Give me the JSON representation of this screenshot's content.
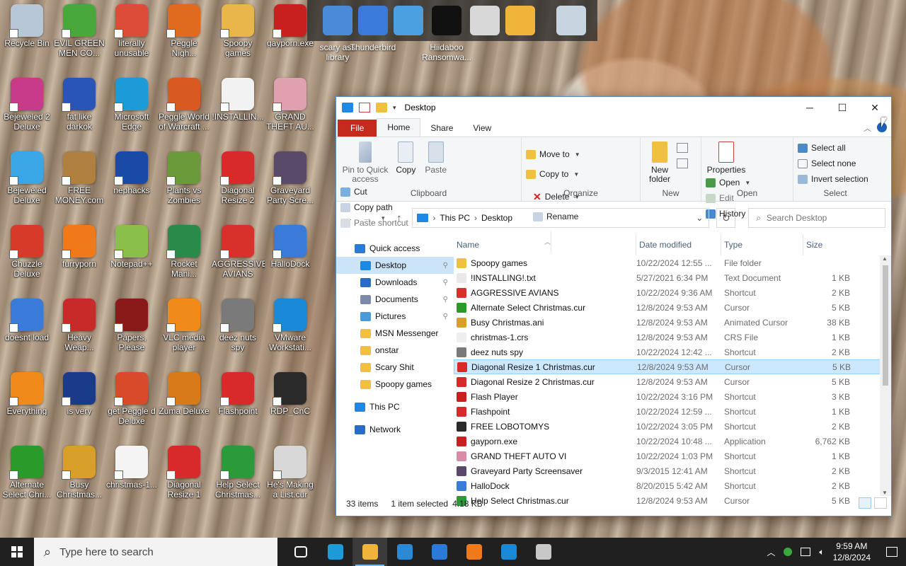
{
  "desktop_icons": [
    {
      "label": "Recycle Bin",
      "icon": "recycle-bin-icon",
      "color": "#b8c7d8"
    },
    {
      "label": "EVIL GREEN MEN CO...",
      "icon": "people-icon",
      "color": "#49a83c"
    },
    {
      "label": "literally unusable",
      "icon": "chrome-icon",
      "color": "#dd4b39"
    },
    {
      "label": "Peggle Nigh...",
      "icon": "peggle-icon",
      "color": "#e06b1f"
    },
    {
      "label": "Spoopy games",
      "icon": "folder-icon",
      "color": "#e8b64a"
    },
    {
      "label": "gayporn.exe",
      "icon": "flash-icon",
      "color": "#c8201e"
    },
    {
      "label": "Bejeweled 2 Deluxe",
      "icon": "gem-icon",
      "color": "#c83a8a"
    },
    {
      "label": "fat like darkok",
      "icon": "mpi-icon",
      "color": "#2a55b8"
    },
    {
      "label": "Microsoft Edge",
      "icon": "edge-icon",
      "color": "#1c9bd8"
    },
    {
      "label": "Peggle World of Warcraft ...",
      "icon": "peggle-icon",
      "color": "#d85a20"
    },
    {
      "label": "!INSTALLIN...",
      "icon": "document-icon",
      "color": "#f2f2f2"
    },
    {
      "label": "GRAND THEFT AU...",
      "icon": "anime-icon",
      "color": "#e0a0b0"
    },
    {
      "label": "Bejeweled Deluxe",
      "icon": "diamond-icon",
      "color": "#3aa6e6"
    },
    {
      "label": "FREE MONEY.com",
      "icon": "money-bag-icon",
      "color": "#b08040"
    },
    {
      "label": "nephacks",
      "icon": "mpi-icon",
      "color": "#1a4aa8"
    },
    {
      "label": "Plants vs Zombies",
      "icon": "plant-icon",
      "color": "#6a9a3a"
    },
    {
      "label": "Diagonal Resize 2 Ch...",
      "icon": "resize-arrow-icon",
      "color": "#d82a2a"
    },
    {
      "label": "Graveyard Party Scre...",
      "icon": "graveyard-icon",
      "color": "#5a4a6a"
    },
    {
      "label": "Chuzzle Deluxe",
      "icon": "chuzzle-icon",
      "color": "#d83a2a"
    },
    {
      "label": "furryporn",
      "icon": "firefox-icon",
      "color": "#f07a1a"
    },
    {
      "label": "Notepad++",
      "icon": "notepad-icon",
      "color": "#8ac04a"
    },
    {
      "label": "Rocket Mani...",
      "icon": "rocket-icon",
      "color": "#2a8a4a"
    },
    {
      "label": "AGGRESSIVE AVIANS",
      "icon": "bird-icon",
      "color": "#d8302a"
    },
    {
      "label": "HalloDock",
      "icon": "shield-icon",
      "color": "#3a7ad8"
    },
    {
      "label": "doesnt load",
      "icon": "thunderbird-icon",
      "color": "#3a7ad8"
    },
    {
      "label": "Heavy Weap...",
      "icon": "radiation-icon",
      "color": "#c82a2a"
    },
    {
      "label": "Papers, Please",
      "icon": "papers-icon",
      "color": "#8a1a1a"
    },
    {
      "label": "VLC media player",
      "icon": "vlc-icon",
      "color": "#f08a1a"
    },
    {
      "label": "deez nuts spy",
      "icon": "windows-stack-icon",
      "color": "#7a7a7a"
    },
    {
      "label": "VMware Workstati...",
      "icon": "vmware-icon",
      "color": "#1a8ad8"
    },
    {
      "label": "Everything",
      "icon": "search-ring-icon",
      "color": "#f08a1a"
    },
    {
      "label": "is very",
      "icon": "mpi-icon",
      "color": "#1a3a8a"
    },
    {
      "label": "get Peggle d Deluxe",
      "icon": "peggle-icon",
      "color": "#d84a2a"
    },
    {
      "label": "Zuma Deluxe",
      "icon": "zuma-icon",
      "color": "#d87a1a"
    },
    {
      "label": "Flashpoint",
      "icon": "flashpoint-icon",
      "color": "#d82a2a"
    },
    {
      "label": "RDP_CnC",
      "icon": "rdp-icon",
      "color": "#2a2a2a"
    },
    {
      "label": "Alternate Select Chri...",
      "icon": "green-arrow-icon",
      "color": "#2a9a2a"
    },
    {
      "label": "Busy Christmas...",
      "icon": "hourglass-icon",
      "color": "#d8a02a"
    },
    {
      "label": "christmas-1...",
      "icon": "blank-file-icon",
      "color": "#f4f4f4"
    },
    {
      "label": "Diagonal Resize 1 Ch...",
      "icon": "resize-arrow-icon",
      "color": "#d82a2a"
    },
    {
      "label": "Help Select Christmas...",
      "icon": "help-cursor-icon",
      "color": "#2a9a3a"
    },
    {
      "label": "He's Making a List.cur",
      "icon": "list-cursor-icon",
      "color": "#d8d8d8"
    }
  ],
  "top_dock": {
    "items": [
      {
        "label": "scary ass library",
        "icon": "network-pcs-icon",
        "color": "#4a8ad8"
      },
      {
        "label": "Thunderbird",
        "icon": "globe-icon",
        "color": "#3a7ad8"
      },
      {
        "label": "",
        "icon": "monitor-icon",
        "color": "#4aa0e0"
      },
      {
        "label": "Hiidaboo Ransomwa...",
        "icon": "yashma-icon",
        "color": "#111111"
      },
      {
        "label": "",
        "icon": "drive-icon",
        "color": "#d8d8d8"
      },
      {
        "label": "",
        "icon": "folder-icon",
        "color": "#f0b43a"
      },
      {
        "label": "",
        "icon": "recycle-bin-icon",
        "color": "#c8d4e0"
      }
    ]
  },
  "window": {
    "title": "Desktop",
    "controls": {
      "minimize": "─",
      "maximize": "☐",
      "close": "✕"
    },
    "tabs": [
      "File",
      "Home",
      "Share",
      "View"
    ],
    "active_tab": "Home",
    "ribbon": {
      "clipboard": {
        "name": "Clipboard",
        "pin": "Pin to Quick access",
        "copy": "Copy",
        "paste": "Paste",
        "cut": "Cut",
        "copy_path": "Copy path",
        "paste_shortcut": "Paste shortcut"
      },
      "organize": {
        "name": "Organize",
        "move_to": "Move to",
        "copy_to": "Copy to",
        "delete": "Delete",
        "rename": "Rename"
      },
      "new": {
        "name": "New",
        "new_folder": "New folder"
      },
      "open": {
        "name": "Open",
        "properties": "Properties",
        "open": "Open",
        "edit": "Edit",
        "history": "History"
      },
      "select": {
        "name": "Select",
        "select_all": "Select all",
        "select_none": "Select none",
        "invert": "Invert selection"
      }
    },
    "address": {
      "this_pc": "This PC",
      "sep": "›",
      "folder": "Desktop"
    },
    "search": {
      "placeholder": "Search Desktop"
    },
    "nav": [
      {
        "label": "Quick access",
        "icon": "star-icon",
        "color": "#2a7ad8",
        "level": 0,
        "pinned": false
      },
      {
        "label": "Desktop",
        "icon": "desktop-icon",
        "color": "#1e88e5",
        "level": 1,
        "pinned": true,
        "selected": true
      },
      {
        "label": "Downloads",
        "icon": "download-icon",
        "color": "#2a6ac8",
        "level": 1,
        "pinned": true
      },
      {
        "label": "Documents",
        "icon": "documents-icon",
        "color": "#7a8aa8",
        "level": 1,
        "pinned": true
      },
      {
        "label": "Pictures",
        "icon": "pictures-icon",
        "color": "#4a9ad8",
        "level": 1,
        "pinned": true
      },
      {
        "label": "MSN Messenger",
        "icon": "folder-icon",
        "color": "#f0c040",
        "level": 1,
        "pinned": false
      },
      {
        "label": "onstar",
        "icon": "folder-icon",
        "color": "#f0c040",
        "level": 1,
        "pinned": false
      },
      {
        "label": "Scary Shit",
        "icon": "folder-icon",
        "color": "#f0c040",
        "level": 1,
        "pinned": false
      },
      {
        "label": "Spoopy games",
        "icon": "folder-icon",
        "color": "#f0c040",
        "level": 1,
        "pinned": false
      },
      {
        "label": "This PC",
        "icon": "pc-icon",
        "color": "#1e88e5",
        "level": 0,
        "pinned": false
      },
      {
        "label": "Network",
        "icon": "network-icon",
        "color": "#2a6ac8",
        "level": 0,
        "pinned": false
      }
    ],
    "columns": [
      "Name",
      "Date modified",
      "Type",
      "Size"
    ],
    "files": [
      {
        "name": "Spoopy games",
        "date": "10/22/2024 12:55 ...",
        "type": "File folder",
        "size": "",
        "icon": "folder-icon",
        "color": "#f0c040"
      },
      {
        "name": "!INSTALLING!.txt",
        "date": "5/27/2021 6:34 PM",
        "type": "Text Document",
        "size": "1 KB",
        "icon": "text-file-icon",
        "color": "#e8e8e8"
      },
      {
        "name": "AGGRESSIVE AVIANS",
        "date": "10/22/2024 9:36 AM",
        "type": "Shortcut",
        "size": "2 KB",
        "icon": "bird-icon",
        "color": "#d8302a"
      },
      {
        "name": "Alternate Select Christmas.cur",
        "date": "12/8/2024 9:53 AM",
        "type": "Cursor",
        "size": "5 KB",
        "icon": "green-arrow-icon",
        "color": "#2a9a2a"
      },
      {
        "name": "Busy Christmas.ani",
        "date": "12/8/2024 9:53 AM",
        "type": "Animated Cursor",
        "size": "38 KB",
        "icon": "hourglass-icon",
        "color": "#d8a02a"
      },
      {
        "name": "christmas-1.crs",
        "date": "12/8/2024 9:53 AM",
        "type": "CRS File",
        "size": "1 KB",
        "icon": "blank-file-icon",
        "color": "#eeeeee"
      },
      {
        "name": "deez nuts spy",
        "date": "10/22/2024 12:42 ...",
        "type": "Shortcut",
        "size": "2 KB",
        "icon": "windows-stack-icon",
        "color": "#7a7a7a"
      },
      {
        "name": "Diagonal Resize 1 Christmas.cur",
        "date": "12/8/2024 9:53 AM",
        "type": "Cursor",
        "size": "5 KB",
        "icon": "resize-arrow-icon",
        "color": "#d82a2a",
        "selected": true
      },
      {
        "name": "Diagonal Resize 2 Christmas.cur",
        "date": "12/8/2024 9:53 AM",
        "type": "Cursor",
        "size": "5 KB",
        "icon": "resize-arrow-icon",
        "color": "#d82a2a"
      },
      {
        "name": "Flash Player",
        "date": "10/22/2024 3:16 PM",
        "type": "Shortcut",
        "size": "3 KB",
        "icon": "flash-icon",
        "color": "#c8201e"
      },
      {
        "name": "Flashpoint",
        "date": "10/22/2024 12:59 ...",
        "type": "Shortcut",
        "size": "1 KB",
        "icon": "flashpoint-icon",
        "color": "#d82a2a"
      },
      {
        "name": "FREE LOBOTOMYS",
        "date": "10/22/2024 3:05 PM",
        "type": "Shortcut",
        "size": "2 KB",
        "icon": "lobotomy-icon",
        "color": "#2a2a2a"
      },
      {
        "name": "gayporn.exe",
        "date": "10/22/2024 10:48 ...",
        "type": "Application",
        "size": "6,762 KB",
        "icon": "flash-icon",
        "color": "#c8201e"
      },
      {
        "name": "GRAND THEFT AUTO VI",
        "date": "10/22/2024 1:03 PM",
        "type": "Shortcut",
        "size": "1 KB",
        "icon": "anime-icon",
        "color": "#d88aa8"
      },
      {
        "name": "Graveyard Party Screensaver",
        "date": "9/3/2015 12:41 AM",
        "type": "Shortcut",
        "size": "2 KB",
        "icon": "graveyard-icon",
        "color": "#5a4a6a"
      },
      {
        "name": "HalloDock",
        "date": "8/20/2015 5:42 AM",
        "type": "Shortcut",
        "size": "2 KB",
        "icon": "shield-icon",
        "color": "#3a7ad8"
      },
      {
        "name": "Help Select Christmas.cur",
        "date": "12/8/2024 9:53 AM",
        "type": "Cursor",
        "size": "5 KB",
        "icon": "help-cursor-icon",
        "color": "#2a9a3a"
      }
    ],
    "status": {
      "items": "33 items",
      "selected": "1 item selected",
      "size": "4.18 KB"
    }
  },
  "taskbar": {
    "search_placeholder": "Type here to search",
    "apps": [
      {
        "icon": "task-view-icon",
        "color": "#ffffff"
      },
      {
        "icon": "edge-icon",
        "color": "#1c9bd8"
      },
      {
        "icon": "file-explorer-icon",
        "color": "#f0b43a",
        "active": true
      },
      {
        "icon": "store-icon",
        "color": "#2a8ad8"
      },
      {
        "icon": "mail-icon",
        "color": "#2a7ad8"
      },
      {
        "icon": "firefox-icon",
        "color": "#f07a1a"
      },
      {
        "icon": "vmware-icon",
        "color": "#1a8ad8"
      },
      {
        "icon": "mouse-icon",
        "color": "#c8c8c8"
      }
    ],
    "time": "9:59 AM",
    "date": "12/8/2024"
  }
}
